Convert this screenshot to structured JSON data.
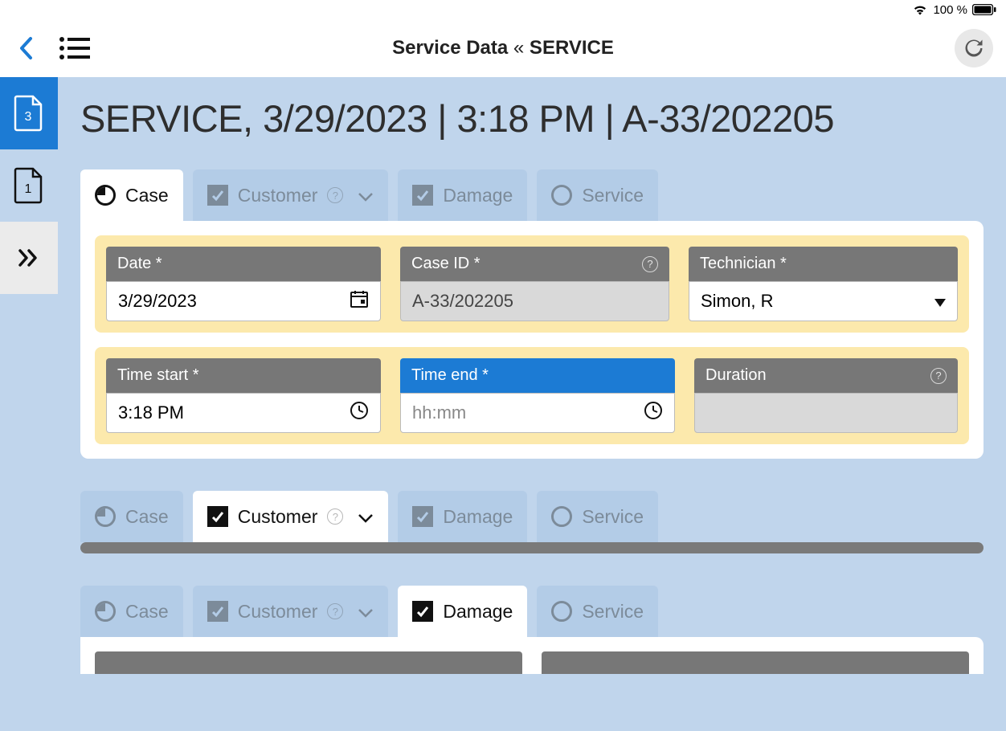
{
  "status": {
    "battery_pct": "100 %"
  },
  "header": {
    "title_left": "Service Data",
    "title_sep": "«",
    "title_right": "SERVICE"
  },
  "sidebar": {
    "badge_a": "3",
    "badge_b": "1"
  },
  "page": {
    "title_service": "SERVICE,",
    "title_rest": " 3/29/2023 | 3:18 PM | A-33/202205"
  },
  "tabs": {
    "case": "Case",
    "customer": "Customer",
    "damage": "Damage",
    "service": "Service"
  },
  "fields": {
    "date": {
      "label": "Date *",
      "value": "3/29/2023"
    },
    "case_id": {
      "label": "Case ID *",
      "value": "A-33/202205"
    },
    "technician": {
      "label": "Technician *",
      "value": "Simon, R"
    },
    "time_start": {
      "label": "Time start *",
      "value": "3:18 PM"
    },
    "time_end": {
      "label": "Time end *",
      "placeholder": "hh:mm",
      "value": ""
    },
    "duration": {
      "label": "Duration",
      "value": ""
    }
  }
}
